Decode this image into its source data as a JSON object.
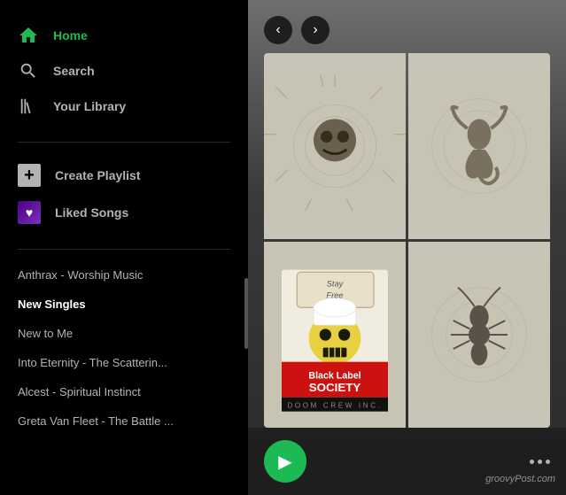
{
  "sidebar": {
    "nav": [
      {
        "id": "home",
        "label": "Home",
        "icon": "home-icon",
        "active": false
      },
      {
        "id": "search",
        "label": "Search",
        "icon": "search-icon",
        "active": false
      },
      {
        "id": "library",
        "label": "Your Library",
        "icon": "library-icon",
        "active": false
      }
    ],
    "actions": [
      {
        "id": "create-playlist",
        "label": "Create Playlist",
        "icon": "plus-icon"
      },
      {
        "id": "liked-songs",
        "label": "Liked Songs",
        "icon": "heart-icon"
      }
    ],
    "playlists": [
      {
        "id": "pl1",
        "label": "Anthrax - Worship Music",
        "highlighted": false
      },
      {
        "id": "pl2",
        "label": "New Singles",
        "highlighted": true
      },
      {
        "id": "pl3",
        "label": "New to Me",
        "highlighted": false
      },
      {
        "id": "pl4",
        "label": "Into Eternity - The Scatterin...",
        "highlighted": false
      },
      {
        "id": "pl5",
        "label": "Alcest - Spiritual Instinct",
        "highlighted": false
      },
      {
        "id": "pl6",
        "label": "Greta Van Fleet - The Battle ...",
        "highlighted": false
      }
    ]
  },
  "main": {
    "nav_back_label": "‹",
    "nav_forward_label": "›",
    "play_label": "▶",
    "more_label": "···",
    "watermark": "groovyPost.com"
  }
}
